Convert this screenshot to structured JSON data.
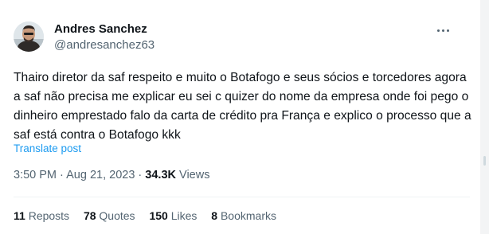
{
  "author": {
    "name": "Andres Sanchez",
    "handle": "@andresanchez63"
  },
  "tweet": {
    "text": "Thairo diretor da saf respeito e muito o Botafogo e seus sócios e torcedores agora a saf não precisa me explicar eu sei c quizer do nome da empresa onde foi pego o dinheiro emprestado falo da carta de crédito pra França e explico o processo que a saf está contra o Botafogo kkk",
    "translate_label": "Translate post",
    "time": "3:50 PM",
    "date": "Aug 21, 2023",
    "separator": "·",
    "views_count": "34.3K",
    "views_label": "Views"
  },
  "stats": [
    {
      "count": "11",
      "label": "Reposts"
    },
    {
      "count": "78",
      "label": "Quotes"
    },
    {
      "count": "150",
      "label": "Likes"
    },
    {
      "count": "8",
      "label": "Bookmarks"
    }
  ],
  "icons": {
    "more": "more-horizontal-icon",
    "avatar": "profile-photo"
  },
  "colors": {
    "text": "#0f1419",
    "secondary": "#536471",
    "link": "#1d9bf0",
    "divider": "#eff3f4"
  }
}
